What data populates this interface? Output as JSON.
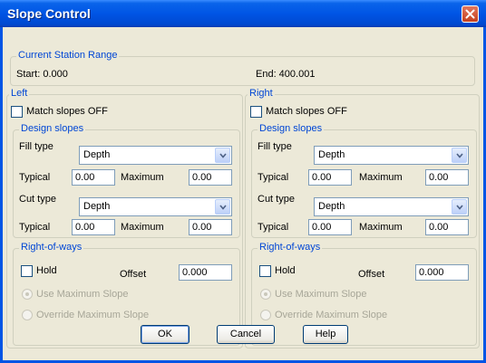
{
  "window": {
    "title": "Slope Control"
  },
  "station_range": {
    "legend": "Current Station Range",
    "start": "Start: 0.000",
    "end": "End: 400.001"
  },
  "left": {
    "legend": "Left",
    "match_slopes_label": "Match slopes OFF",
    "design_slopes": {
      "legend": "Design slopes",
      "fill_type_label": "Fill type",
      "fill_type_value": "Depth",
      "fill_typical_label": "Typical",
      "fill_typical_value": "0.00",
      "fill_maximum_label": "Maximum",
      "fill_maximum_value": "0.00",
      "cut_type_label": "Cut type",
      "cut_type_value": "Depth",
      "cut_typical_label": "Typical",
      "cut_typical_value": "0.00",
      "cut_maximum_label": "Maximum",
      "cut_maximum_value": "0.00"
    },
    "row": {
      "legend": "Right-of-ways",
      "hold_label": "Hold",
      "offset_label": "Offset",
      "offset_value": "0.000",
      "use_max_label": "Use Maximum Slope",
      "override_max_label": "Override Maximum Slope"
    }
  },
  "right": {
    "legend": "Right",
    "match_slopes_label": "Match slopes OFF",
    "design_slopes": {
      "legend": "Design slopes",
      "fill_type_label": "Fill type",
      "fill_type_value": "Depth",
      "fill_typical_label": "Typical",
      "fill_typical_value": "0.00",
      "fill_maximum_label": "Maximum",
      "fill_maximum_value": "0.00",
      "cut_type_label": "Cut type",
      "cut_type_value": "Depth",
      "cut_typical_label": "Typical",
      "cut_typical_value": "0.00",
      "cut_maximum_label": "Maximum",
      "cut_maximum_value": "0.00"
    },
    "row": {
      "legend": "Right-of-ways",
      "hold_label": "Hold",
      "offset_label": "Offset",
      "offset_value": "0.000",
      "use_max_label": "Use Maximum Slope",
      "override_max_label": "Override Maximum Slope"
    }
  },
  "buttons": {
    "ok": "OK",
    "cancel": "Cancel",
    "help": "Help"
  },
  "icons": {
    "close": "close-icon",
    "dropdown": "chevron-down-icon"
  },
  "colors": {
    "titlebar": "#0055e5",
    "legend_text": "#0046d5",
    "dialog_bg": "#ece9d8",
    "close_button": "#d9582f"
  }
}
